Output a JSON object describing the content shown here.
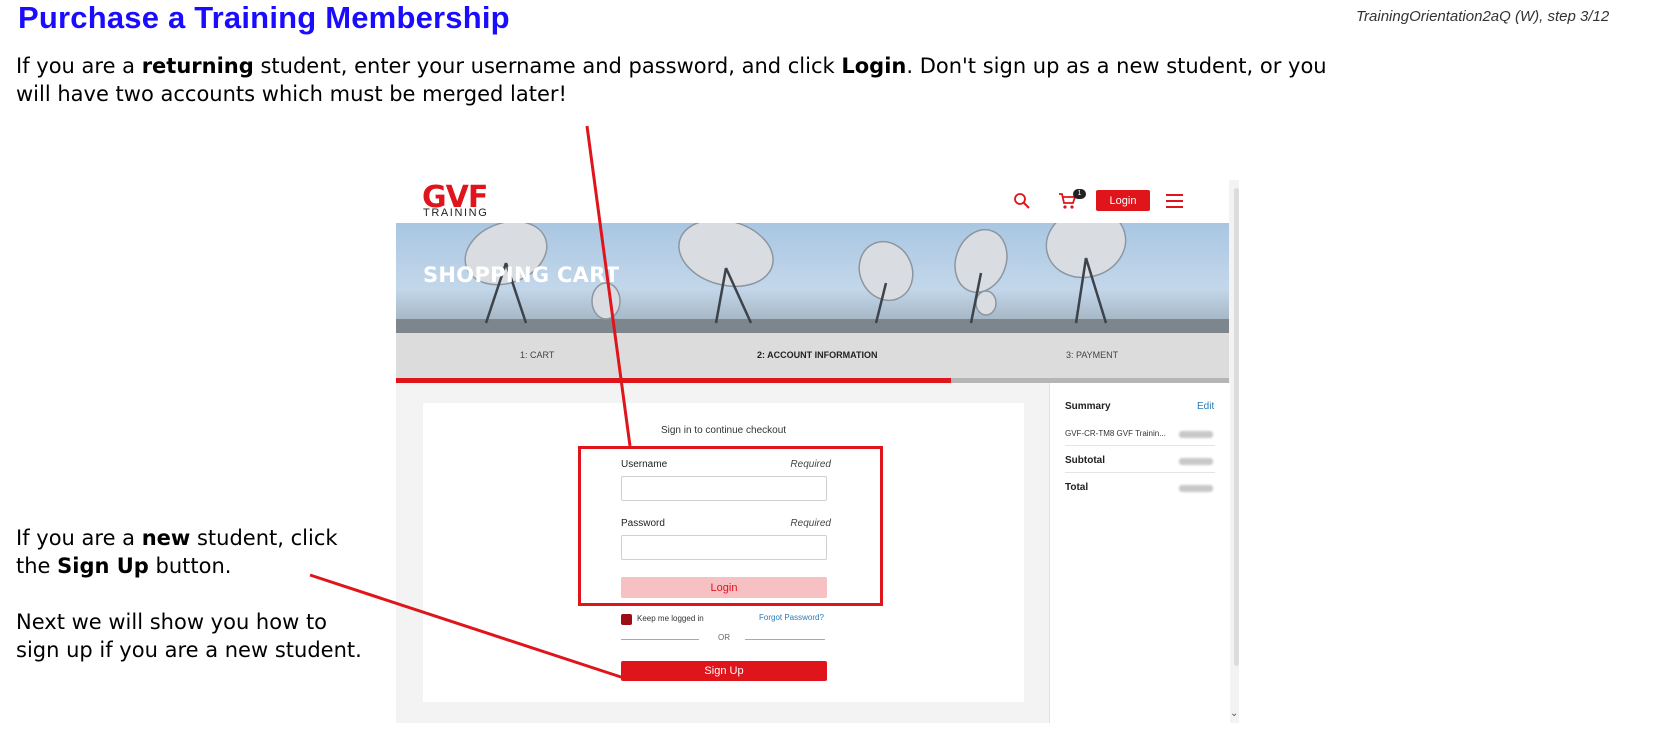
{
  "page": {
    "title": "Purchase a Training Membership",
    "step_info": "TrainingOrientation2aQ (W), step 3/12"
  },
  "intro": {
    "p1": "If you are a ",
    "b1": "returning",
    "p2": " student, enter your username and password, and click ",
    "b2": "Login",
    "p3": ".  Don't sign up as a new student, or you will have two accounts which must be merged later!"
  },
  "side_note": {
    "a1": "If you are a ",
    "b1": "new",
    "a2": " student, click the ",
    "b2": "Sign Up",
    "a3": " button.",
    "p2": "Next we will show you how to sign up if you are a new student."
  },
  "site": {
    "logo": "GVF",
    "logo_sub": "TRAINING",
    "cart_count": "1",
    "header_login": "Login",
    "hero_title": "SHOPPING CART",
    "steps": [
      "1: CART",
      "2: ACCOUNT INFORMATION",
      "3: PAYMENT"
    ],
    "active_step": 1,
    "progress_fraction": 0.667
  },
  "login_form": {
    "caption": "Sign in to continue checkout",
    "username_label": "Username",
    "username_required": "Required",
    "username_value": "",
    "password_label": "Password",
    "password_required": "Required",
    "password_value": "",
    "login_button": "Login",
    "keep_logged_in": "Keep me logged in",
    "forgot_password": "Forgot Password?",
    "or": "OR",
    "signup_button": "Sign Up"
  },
  "summary": {
    "title": "Summary",
    "edit": "Edit",
    "item": "GVF-CR-TM8 GVF Trainin...",
    "subtotal": "Subtotal",
    "total": "Total"
  },
  "colors": {
    "title_blue": "#1a0dff",
    "brand_red": "#e0141b",
    "link_blue": "#2a7ab8"
  },
  "icons": [
    "search-icon",
    "cart-icon",
    "menu-icon",
    "chevron-down-icon"
  ]
}
